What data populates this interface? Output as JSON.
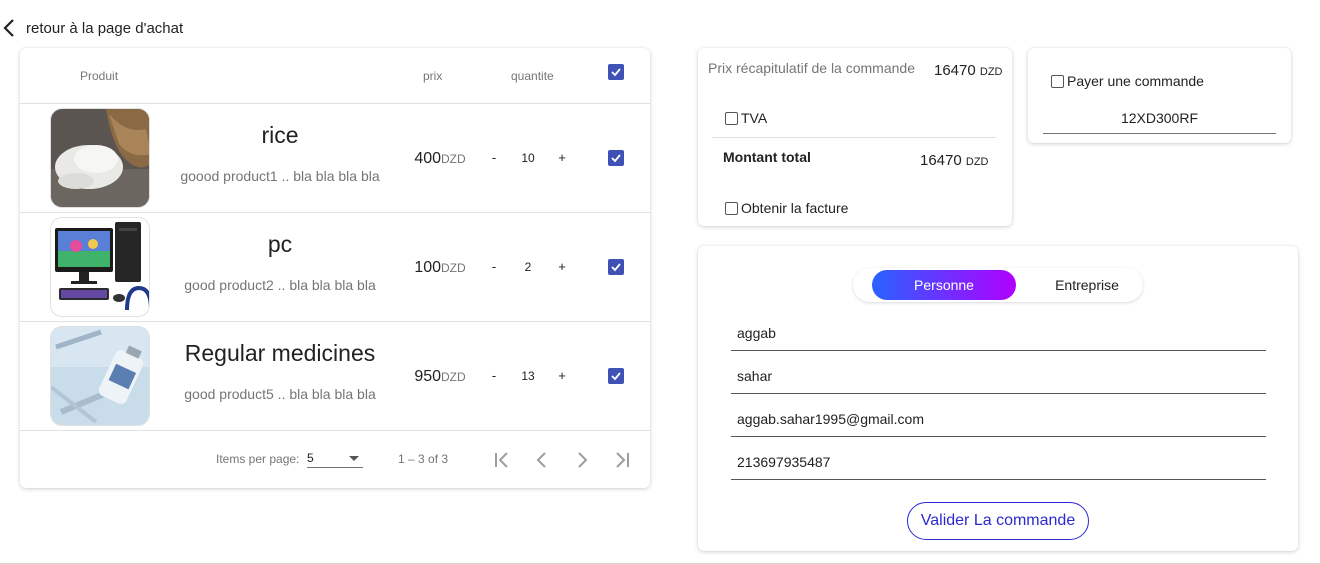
{
  "back": {
    "label": "retour à la page d'achat"
  },
  "table": {
    "headers": {
      "product": "Produit",
      "price": "prix",
      "quantity": "quantite"
    },
    "select_all_checked": true,
    "rows": [
      {
        "image": "rice-photo",
        "name": "rice",
        "description": "goood product1 .. bla bla bla bla",
        "price": "400",
        "currency": "DZD",
        "quantity": "10",
        "checked": true,
        "minus": "-",
        "plus": "+"
      },
      {
        "image": "pc-photo",
        "name": "pc",
        "description": "good product2 .. bla bla bla bla",
        "price": "100",
        "currency": "DZD",
        "quantity": "2",
        "checked": true,
        "minus": "-",
        "plus": "+"
      },
      {
        "image": "medicine-photo",
        "name": "Regular medicines",
        "description": "good product5 .. bla bla bla bla",
        "price": "950",
        "currency": "DZD",
        "quantity": "13",
        "checked": true,
        "minus": "-",
        "plus": "+"
      }
    ],
    "paginator": {
      "items_per_page_label": "Items per page:",
      "items_per_page": "5",
      "range": "1 – 3 of 3"
    }
  },
  "summary": {
    "label": "Prix récapitulatif de la commande",
    "amount": "16470",
    "currency": "DZD",
    "tva_label": "TVA",
    "total_label": "Montant total",
    "total_amount": "16470",
    "total_currency": "DZD",
    "invoice_label": "Obtenir la facture"
  },
  "coupon": {
    "label": "Payer une commande",
    "value": "12XD300RF"
  },
  "form": {
    "toggle": {
      "active": "Personne",
      "inactive": "Entreprise"
    },
    "fields": [
      "aggab",
      "sahar",
      "aggab.sahar1995@gmail.com",
      "213697935487"
    ],
    "submit_label": "Valider La commande"
  },
  "colors": {
    "checkbox": "#3f51b5",
    "gradient_start": "#2962ff",
    "gradient_end": "#b000ff",
    "submit": "#2a2ad0"
  }
}
